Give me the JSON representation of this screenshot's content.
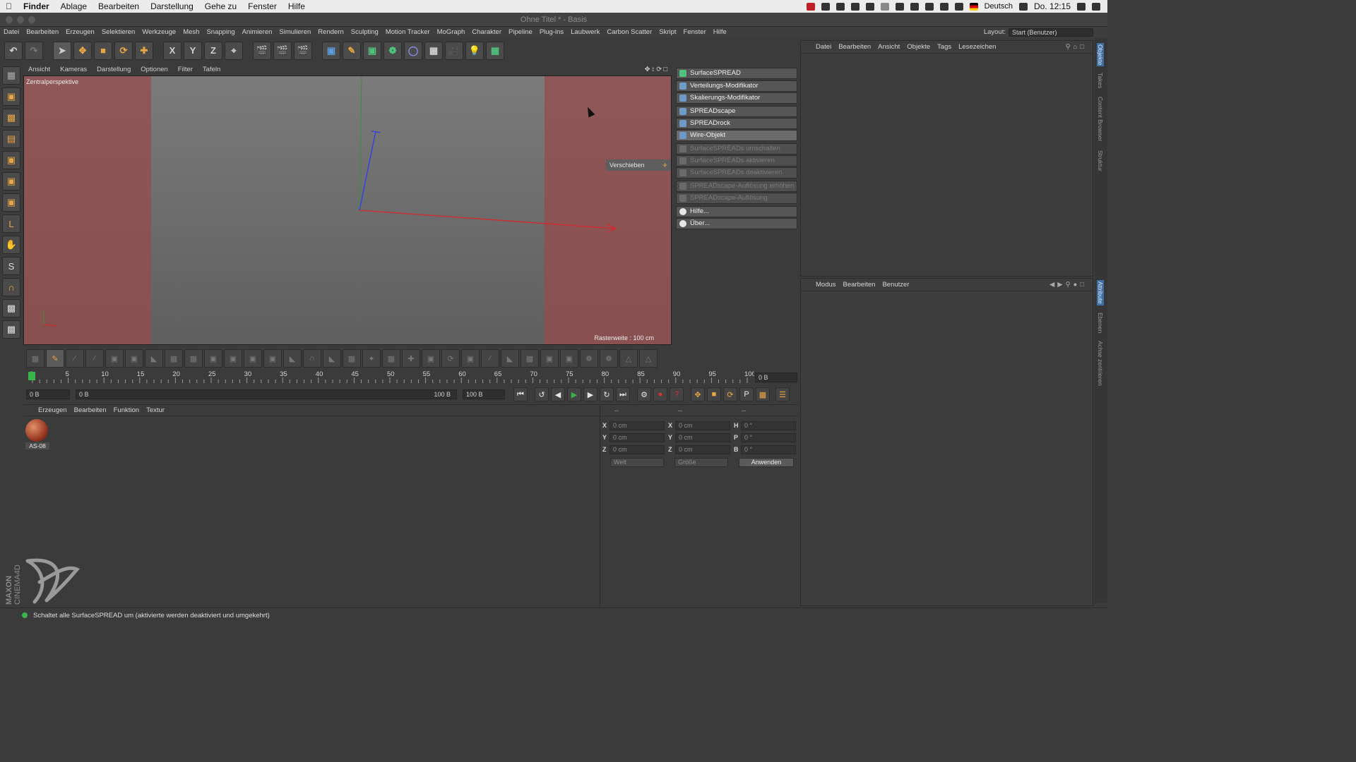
{
  "mac_menubar": {
    "items": [
      "Finder",
      "Ablage",
      "Bearbeiten",
      "Darstellung",
      "Gehe zu",
      "Fenster",
      "Hilfe"
    ],
    "language": "Deutsch",
    "clock": "Do. 12:15"
  },
  "window": {
    "title": "Ohne Titel * - Basis"
  },
  "app_menu": {
    "items": [
      "Datei",
      "Bearbeiten",
      "Erzeugen",
      "Selektieren",
      "Werkzeuge",
      "Mesh",
      "Snapping",
      "Animieren",
      "Simulieren",
      "Rendern",
      "Sculpting",
      "Motion Tracker",
      "MoGraph",
      "Charakter",
      "Pipeline",
      "Plug-ins",
      "Laubwerk",
      "Carbon Scatter",
      "Skript",
      "Fenster",
      "Hilfe"
    ],
    "layout_label": "Layout:",
    "layout_value": "Start (Benutzer)"
  },
  "toolbar": {
    "axis_buttons": [
      "X",
      "Y",
      "Z"
    ]
  },
  "viewport": {
    "menu": [
      "Ansicht",
      "Kameras",
      "Darstellung",
      "Optionen",
      "Filter",
      "Tafeln"
    ],
    "view_name": "Zentralperspektive",
    "grid_info": "Rasterweite : 100 cm",
    "tooltip": "Verschieben"
  },
  "plugin_menu": {
    "items": [
      {
        "label": "SurfaceSPREAD",
        "state": "normal"
      },
      {
        "label": "Verteilungs-Modifikator",
        "state": "normal"
      },
      {
        "label": "Skalierungs-Modifikator",
        "state": "normal"
      },
      {
        "label": "SPREADscape",
        "state": "normal"
      },
      {
        "label": "SPREADrock",
        "state": "normal"
      },
      {
        "label": "Wire-Objekt",
        "state": "selected"
      },
      {
        "label": "SurfaceSPREADs umschalten",
        "state": "disabled"
      },
      {
        "label": "SurfaceSPREADs aktivieren",
        "state": "disabled"
      },
      {
        "label": "SurfaceSPREADs deaktivieren",
        "state": "disabled"
      },
      {
        "label": "SPREADscape-Auflösung erhöhen",
        "state": "disabled"
      },
      {
        "label": "SPREADscape-Auflösung verringern",
        "state": "disabled"
      },
      {
        "label": "Hilfe...",
        "state": "normal"
      },
      {
        "label": "Über...",
        "state": "normal"
      }
    ]
  },
  "object_manager": {
    "menu": [
      "Datei",
      "Bearbeiten",
      "Ansicht",
      "Objekte",
      "Tags",
      "Lesezeichen"
    ]
  },
  "attribute_manager": {
    "menu": [
      "Modus",
      "Bearbeiten",
      "Benutzer"
    ]
  },
  "side_tabs": [
    "Objekte",
    "Takes",
    "Content Browser",
    "Struktur",
    "Attribute",
    "Ebenen",
    "Achse zentrieren"
  ],
  "timeline": {
    "ticks": [
      "0",
      "5",
      "10",
      "15",
      "20",
      "25",
      "30",
      "35",
      "40",
      "45",
      "50",
      "55",
      "60",
      "65",
      "70",
      "75",
      "80",
      "85",
      "90",
      "95",
      "100"
    ],
    "current_frame": "0 B",
    "start_field": "0 B",
    "range_start": "0 B",
    "range_end": "100 B",
    "end_field": "100 B"
  },
  "material_manager": {
    "menu": [
      "Erzeugen",
      "Bearbeiten",
      "Funktion",
      "Textur"
    ],
    "material_name": "AS-08"
  },
  "coordinates": {
    "header_dashes": [
      "--",
      "--",
      "--"
    ],
    "rows": [
      {
        "axis": "X",
        "pos": "0 cm",
        "size_axis": "X",
        "size": "0 cm",
        "rot_axis": "H",
        "rot": "0 °"
      },
      {
        "axis": "Y",
        "pos": "0 cm",
        "size_axis": "Y",
        "size": "0 cm",
        "rot_axis": "P",
        "rot": "0 °"
      },
      {
        "axis": "Z",
        "pos": "0 cm",
        "size_axis": "Z",
        "size": "0 cm",
        "rot_axis": "B",
        "rot": "0 °"
      }
    ],
    "space_dropdown": "Welt",
    "size_dropdown": "Größe",
    "apply_button": "Anwenden"
  },
  "status": {
    "message": "Schaltet alle SurfaceSPREAD um (aktivierte werden deaktiviert und umgekehrt)"
  },
  "branding": {
    "logo_text": "MAXON CINEMA4D"
  }
}
